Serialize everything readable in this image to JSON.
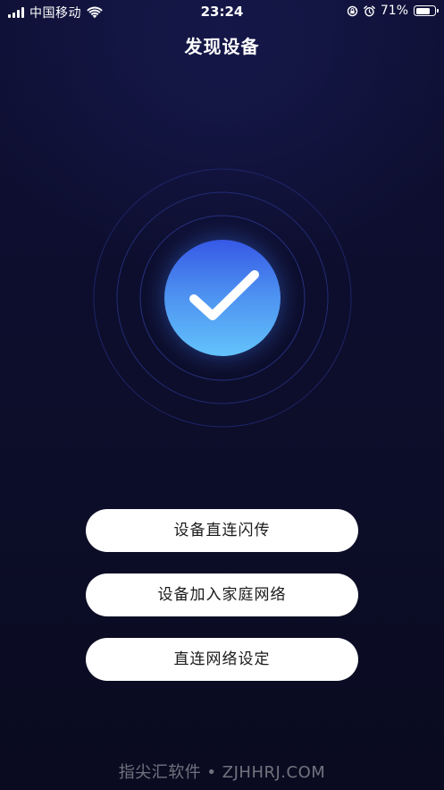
{
  "status_bar": {
    "carrier": "中国移动",
    "time": "23:24",
    "battery_percent_text": "71%",
    "battery_level": 0.71,
    "icons": [
      "signal-icon",
      "wifi-icon",
      "rotation-lock-icon",
      "alarm-icon",
      "battery-icon"
    ]
  },
  "header": {
    "title": "发现设备"
  },
  "status_visual": {
    "icon": "checkmark-icon",
    "colors": {
      "gradient_top": "#3658e6",
      "gradient_bottom": "#63c3fb",
      "ring": "#2a3a8a"
    }
  },
  "actions": {
    "direct_flash_label": "设备直连闪传",
    "join_home_network_label": "设备加入家庭网络",
    "direct_network_settings_label": "直连网络设定"
  },
  "watermark": {
    "text": "指尖汇软件 • ZJHHRJ.COM"
  },
  "theme": {
    "background": "#0d0e2c",
    "button_bg": "#ffffff",
    "button_text": "#1a1a1a"
  }
}
